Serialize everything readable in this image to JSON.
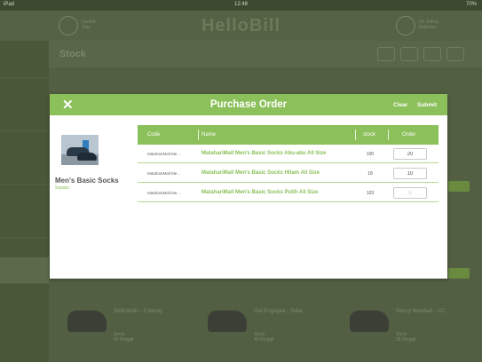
{
  "status_bar": {
    "device": "iPad",
    "time": "12:48",
    "battery": "70%"
  },
  "app": {
    "logo": "HelloBill",
    "header_left": {
      "line1": "Dentist",
      "line2": "Stay"
    },
    "header_right": {
      "line1": "Sir Jeffrey",
      "line2": "Malhotra"
    },
    "page_title": "Stock",
    "cards": [
      {
        "title": "Sollicitudin - Fubeng",
        "stock_label": "Stock",
        "stock_value": "60 Ringgit"
      },
      {
        "title": "Get Engaged - Setia",
        "stock_label": "Stock",
        "stock_value": "40 Ringgit"
      },
      {
        "title": "Nancy Mowbad - CC",
        "stock_label": "Stock",
        "stock_value": "28 Ringgit"
      }
    ]
  },
  "modal": {
    "title": "Purchase Order",
    "close_icon": "close-icon",
    "clear_label": "Clear",
    "submit_label": "Submit",
    "product": {
      "name": "Men's Basic Socks",
      "category": "Sepatu"
    },
    "columns": {
      "code": "Code",
      "name": "Name",
      "stock": "stock",
      "order": "Order"
    },
    "rows": [
      {
        "code": "MatahariMall Me…",
        "name": "MatahariMall Men's Basic Socks Abu-abu All Size",
        "stock": "100",
        "order": "20",
        "placeholder": "0"
      },
      {
        "code": "MatahariMall Me…",
        "name": "MatahariMall Men's Basic Socks Hitam All Size",
        "stock": "18",
        "order": "10",
        "placeholder": "0"
      },
      {
        "code": "MatahariMall Me…",
        "name": "MatahariMall Men's Basic Socks Putih All Size",
        "stock": "103",
        "order": "",
        "placeholder": "0"
      }
    ],
    "accent_color": "#8bc05a"
  }
}
